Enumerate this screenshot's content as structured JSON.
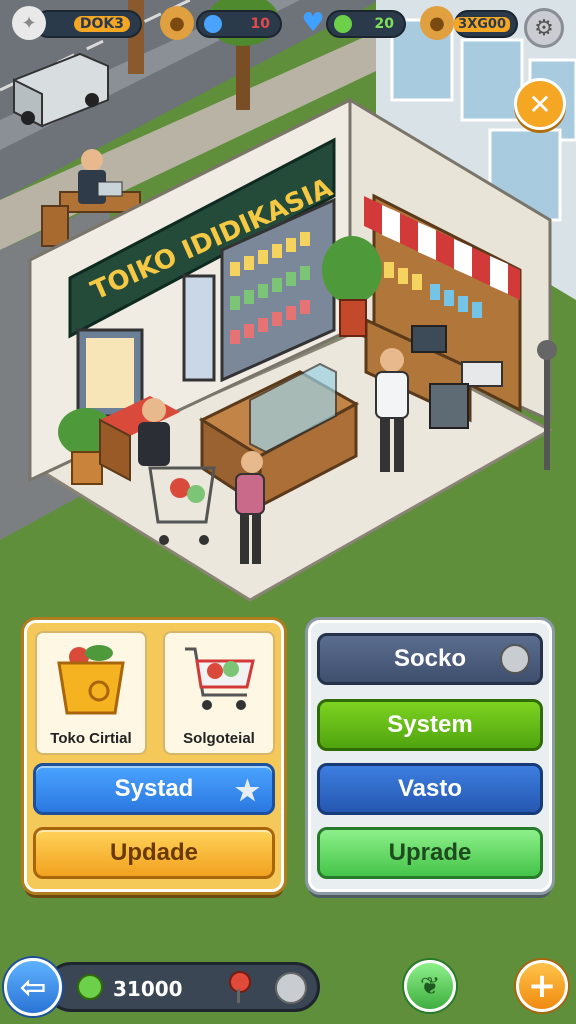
{
  "hud": {
    "res1_value": "DOK3",
    "res2_value": "10",
    "res3_value": "20",
    "res4_value": "3XG00"
  },
  "store_sign": "TOIKO IDIDIKASIA",
  "left_panel": {
    "card1_label": "Toko Cirtial",
    "card2_label": "Solgoteial",
    "btn1_label": "Systad",
    "btn2_label": "Updade"
  },
  "right_panel": {
    "btn1_label": "Socko",
    "btn2_label": "System",
    "btn3_label": "Vasto",
    "btn4_label": "Uprade"
  },
  "bottom": {
    "coin_value": "31000"
  },
  "icons": {
    "close": "✕",
    "back": "⇦",
    "add": "+",
    "gear": "⚙"
  },
  "colors": {
    "accent_orange": "#f5a623",
    "accent_blue": "#2b78e0",
    "grass": "#5f8f3a"
  }
}
